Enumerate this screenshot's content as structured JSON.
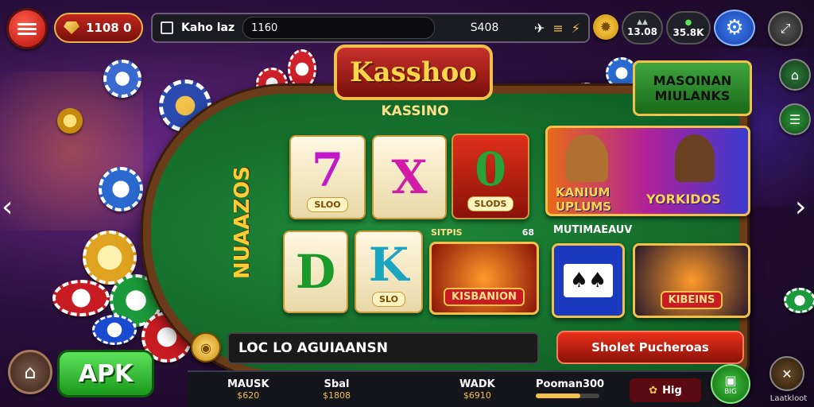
{
  "topbar": {
    "coin_balance": "1108  0",
    "search_label": "Kaho laz",
    "search_value": "1160",
    "center_value": "S408",
    "pill_a": "13.08",
    "pill_b": "35.8K"
  },
  "logo": {
    "title": "Kasshoo",
    "subtitle": "KASSINO"
  },
  "table": {
    "side_label": "NUAAZOS"
  },
  "cards": [
    {
      "glyph": "7",
      "tag": "SLOO",
      "color": "#1aa5e0"
    },
    {
      "glyph": "X",
      "tag": "",
      "color": "#d21ca7"
    },
    {
      "glyph": "0",
      "tag": "SLODS",
      "color": "#2aa23a"
    },
    {
      "glyph": "D",
      "tag": "",
      "color": "#1a9a2a"
    },
    {
      "glyph": "K",
      "tag": "SLO",
      "color": "#1aa5c0"
    }
  ],
  "promos": {
    "right_title": "MASOINAN MIULANKS",
    "hero_left": "KANIUM UPLUMS",
    "hero_right": "YORKIDOS",
    "section_label": "MUTIMAEAUV",
    "slot_label_left": "SITPIS",
    "slot_label_right": "68",
    "slot_banner": "KISBANION",
    "cards_banner": "KIBEINS"
  },
  "ticker": {
    "text": "LOC  LO  AGUIAANSN",
    "cta": "Sholet Pucheroas"
  },
  "apk_button": "APK",
  "bottom": {
    "items": [
      {
        "label": "MAUSK",
        "value": "$620"
      },
      {
        "label": "Sbal",
        "value": "$1808"
      },
      {
        "label": "WADK",
        "value": "$6910"
      },
      {
        "label": "Pooman300",
        "value": ""
      },
      {
        "label": "Hig",
        "value": ""
      }
    ],
    "right_caption": "Laatkloot",
    "badge_caption": "BIG"
  }
}
